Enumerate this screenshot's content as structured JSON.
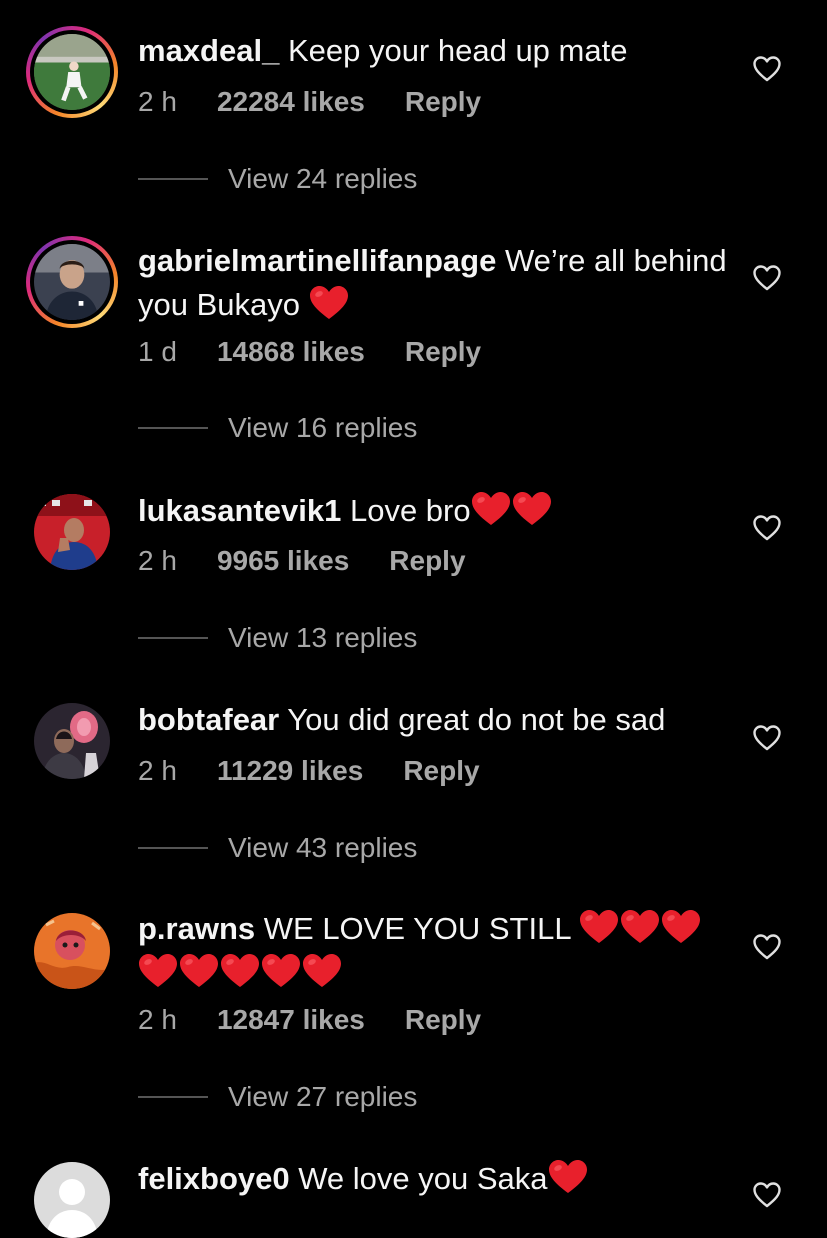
{
  "colors": {
    "background": "#000000",
    "text_primary": "#f5f5f5",
    "text_secondary": "#a8a8a8",
    "heart_emoji": "#e8202c"
  },
  "comments": [
    {
      "username": "maxdeal_",
      "text": " Keep your head up mate",
      "hearts_inline": 0,
      "hearts_line2": 0,
      "time": "2 h",
      "likes": "22284 likes",
      "reply_label": "Reply",
      "view_replies": "View 24 replies",
      "like_icon": "heart-outline-icon"
    },
    {
      "username": "gabrielmartinellifanpage",
      "text": " We’re all behind you Bukayo ",
      "hearts_inline": 1,
      "hearts_line2": 0,
      "time": "1 d",
      "likes": "14868 likes",
      "reply_label": "Reply",
      "view_replies": "View 16 replies",
      "like_icon": "heart-outline-icon"
    },
    {
      "username": "lukasantevik1",
      "text": " Love bro",
      "hearts_inline": 2,
      "hearts_line2": 0,
      "time": "2 h",
      "likes": "9965 likes",
      "reply_label": "Reply",
      "view_replies": "View 13 replies",
      "like_icon": "heart-outline-icon"
    },
    {
      "username": "bobtafear",
      "text": " You did great do not be sad",
      "hearts_inline": 0,
      "hearts_line2": 0,
      "time": "2 h",
      "likes": "11229 likes",
      "reply_label": "Reply",
      "view_replies": "View 43 replies",
      "like_icon": "heart-outline-icon"
    },
    {
      "username": "p.rawns",
      "text": " WE LOVE YOU STILL ",
      "hearts_inline": 3,
      "hearts_line2": 5,
      "time": "2 h",
      "likes": "12847 likes",
      "reply_label": "Reply",
      "view_replies": "View 27 replies",
      "like_icon": "heart-outline-icon"
    },
    {
      "username": "felixboye0",
      "text": " We love you Saka",
      "hearts_inline": 1,
      "hearts_line2": 0,
      "like_icon": "heart-outline-icon"
    }
  ]
}
